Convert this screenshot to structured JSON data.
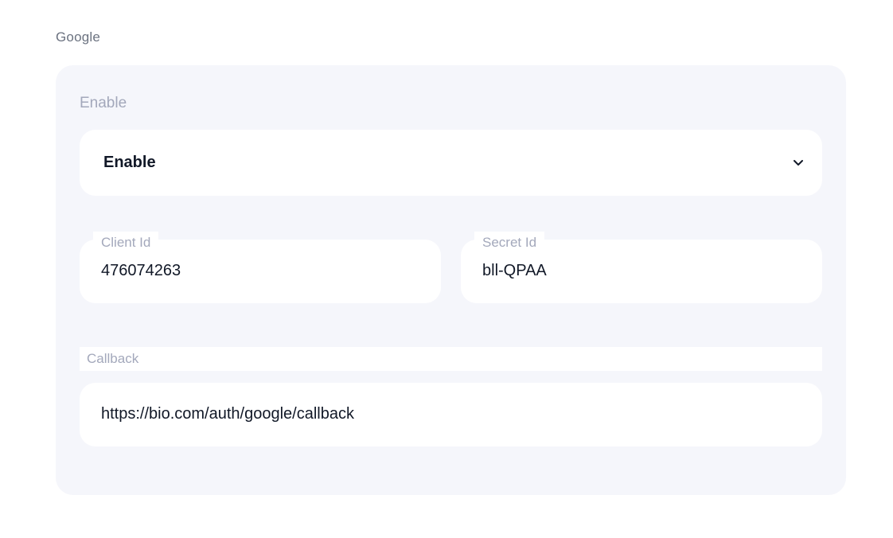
{
  "section": {
    "title": "Google"
  },
  "enable": {
    "label": "Enable",
    "selected": "Enable"
  },
  "client_id": {
    "label": "Client Id",
    "value": "476074263"
  },
  "secret_id": {
    "label": "Secret Id",
    "value": "bll-QPAA"
  },
  "callback": {
    "label": "Callback",
    "value": "https://bio.com/auth/google/callback"
  }
}
